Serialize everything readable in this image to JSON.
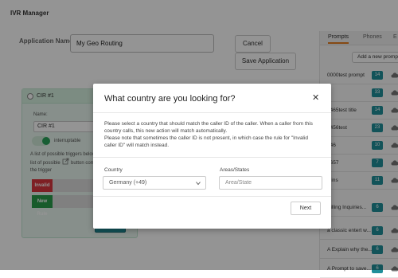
{
  "app": {
    "title": "IVR Manager"
  },
  "form": {
    "application_name_label": "Application Name:",
    "application_name_value": "My Geo Routing",
    "cancel_label": "Cancel",
    "save_label": "Save Application"
  },
  "right_panel": {
    "tabs": [
      "Prompts",
      "Phones",
      "E"
    ],
    "add_prompt_label": "Add a new prompt",
    "prompts": [
      {
        "name": "0000test prompt",
        "count": "14"
      },
      {
        "name": "3",
        "count": "33"
      },
      {
        "name": "3465test title",
        "count": "14"
      },
      {
        "name": "3456test",
        "count": "23"
      },
      {
        "name": "246",
        "count": "10"
      },
      {
        "name": "4657",
        "count": "7"
      },
      {
        "name": "mins",
        "count": "11"
      },
      {
        "name": "Billing Inquiries...",
        "count": "6"
      },
      {
        "name": "a classic entert w...",
        "count": "6"
      },
      {
        "name": "A Explain why the...",
        "count": "6"
      },
      {
        "name": "A Prompt to save...",
        "count": "6"
      }
    ]
  },
  "node": {
    "title": "CIR #1",
    "name_label": "Name:",
    "name_value": "CIR #1",
    "toggle_label": "interruptable",
    "triggers_text": "A list of possible triggers below",
    "triggers_text2": "list of possible",
    "triggers_text3": "button com",
    "triggers_text4": "the trigger",
    "invalid_tag": "Invalid",
    "new_rule_tag": "New Rule",
    "close_label": "Close"
  },
  "modal": {
    "title": "What country are you looking for?",
    "close_symbol": "✕",
    "description1": "Please select a country that should match the caller ID of the caller. When a caller from this country calls, this new action will match automatically.",
    "description2": "Please note that sometimes the caller ID is not present, in which case the rule for \"Invalid caller ID\" will match instead.",
    "country_label": "Country",
    "country_value": "Germany (+49)",
    "area_label": "Areas/States",
    "area_placeholder": "Area/State",
    "next_label": "Next"
  },
  "colors": {
    "accent_teal": "#1f8f9a",
    "node_green": "#e9f7ef",
    "tab_active_underline": "#e67e22",
    "invalid_red": "#d9363e",
    "new_rule_green": "#2a9d4a"
  }
}
